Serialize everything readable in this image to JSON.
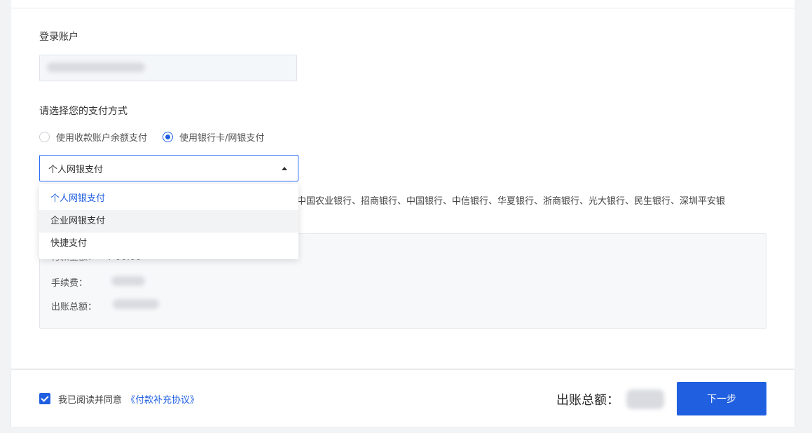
{
  "account": {
    "label": "登录账户"
  },
  "payment": {
    "label": "请选择您的支付方式",
    "options": [
      {
        "label": "使用收款账户余额支付",
        "checked": false
      },
      {
        "label": "使用银行卡/网银支付",
        "checked": true
      }
    ],
    "select": {
      "value": "个人网银支付",
      "items": [
        "个人网银支付",
        "企业网银支付",
        "快捷支付"
      ]
    },
    "banks_text": "中国农业银行、招商银行、中国银行、中信银行、华夏银行、浙商银行、光大银行、民生银行、深圳平安银"
  },
  "summary": {
    "partial_label": "付款金额：",
    "partial_value": "¥ 00.00",
    "fee_label": "手续费：",
    "total_label": "出账总额："
  },
  "footer": {
    "agree_text": "我已阅读并同意",
    "agreement_link": "《付款补充协议》",
    "total_label": "出账总额：",
    "next_button": "下一步"
  },
  "colors": {
    "accent": "#1f5fe0",
    "background": "#f2f3f5"
  }
}
